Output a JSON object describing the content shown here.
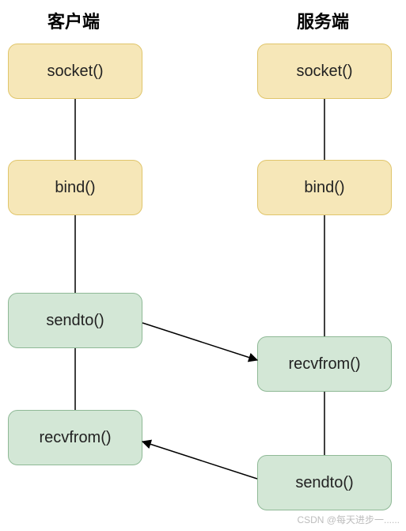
{
  "headers": {
    "client": "客户端",
    "server": "服务端"
  },
  "client": {
    "socket": "socket()",
    "bind": "bind()",
    "sendto": "sendto()",
    "recvfrom": "recvfrom()"
  },
  "server": {
    "socket": "socket()",
    "bind": "bind()",
    "recvfrom": "recvfrom()",
    "sendto": "sendto()"
  },
  "watermark": "CSDN @每天进步一......",
  "chart_data": {
    "type": "diagram",
    "title": "UDP socket flow (client-server)",
    "columns": [
      {
        "id": "client",
        "label": "客户端"
      },
      {
        "id": "server",
        "label": "服务端"
      }
    ],
    "nodes": [
      {
        "id": "c_socket",
        "column": "client",
        "label": "socket()",
        "color": "#f6e7b8",
        "order": 1
      },
      {
        "id": "c_bind",
        "column": "client",
        "label": "bind()",
        "color": "#f6e7b8",
        "order": 2
      },
      {
        "id": "c_sendto",
        "column": "client",
        "label": "sendto()",
        "color": "#d3e7d6",
        "order": 3
      },
      {
        "id": "c_recv",
        "column": "client",
        "label": "recvfrom()",
        "color": "#d3e7d6",
        "order": 4
      },
      {
        "id": "s_socket",
        "column": "server",
        "label": "socket()",
        "color": "#f6e7b8",
        "order": 1
      },
      {
        "id": "s_bind",
        "column": "server",
        "label": "bind()",
        "color": "#f6e7b8",
        "order": 2
      },
      {
        "id": "s_recv",
        "column": "server",
        "label": "recvfrom()",
        "color": "#d3e7d6",
        "order": 3
      },
      {
        "id": "s_sendto",
        "column": "server",
        "label": "sendto()",
        "color": "#d3e7d6",
        "order": 4
      }
    ],
    "edges": [
      {
        "from": "c_socket",
        "to": "c_bind",
        "directed": false
      },
      {
        "from": "c_bind",
        "to": "c_sendto",
        "directed": false
      },
      {
        "from": "c_sendto",
        "to": "c_recv",
        "directed": false
      },
      {
        "from": "s_socket",
        "to": "s_bind",
        "directed": false
      },
      {
        "from": "s_bind",
        "to": "s_recv",
        "directed": false
      },
      {
        "from": "s_recv",
        "to": "s_sendto",
        "directed": false
      },
      {
        "from": "c_sendto",
        "to": "s_recv",
        "directed": true
      },
      {
        "from": "s_sendto",
        "to": "c_recv",
        "directed": true
      }
    ]
  }
}
